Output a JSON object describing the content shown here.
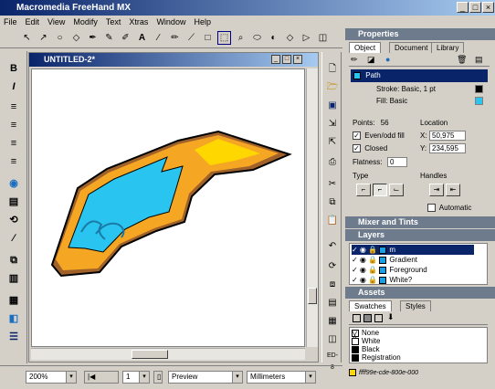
{
  "window": {
    "title": "Macromedia FreeHand MX",
    "min": "_",
    "max": "□",
    "close": "×"
  },
  "menu": [
    "File",
    "Edit",
    "View",
    "Modify",
    "Text",
    "Xtras",
    "Window",
    "Help"
  ],
  "document": {
    "title": "UNTITLED-2*"
  },
  "properties": {
    "header": "Properties",
    "tabs": [
      "Object",
      "Document",
      "Library"
    ],
    "path_label": "Path",
    "stroke_label": "Stroke: Basic, 1 pt",
    "fill_label": "Fill: Basic",
    "points_label": "Points:",
    "points_value": "56",
    "evenodd_label": "Even/odd fill",
    "closed_label": "Closed",
    "flatness_label": "Flatness:",
    "flatness_value": "0",
    "type_label": "Type",
    "location_label": "Location",
    "x_label": "X:",
    "x_value": "50,975",
    "y_label": "Y:",
    "y_value": "234,595",
    "handles_label": "Handles",
    "automatic_label": "Automatic"
  },
  "mixer": {
    "header": "Mixer and Tints"
  },
  "layers": {
    "header": "Layers",
    "items": [
      {
        "name": "m",
        "color": "#1b9ee3"
      },
      {
        "name": "Gradient",
        "color": "#1b9ee3"
      },
      {
        "name": "Foreground",
        "color": "#1b9ee3"
      },
      {
        "name": "White?",
        "color": "#1b9ee3"
      }
    ]
  },
  "assets": {
    "header": "Assets",
    "tabs": [
      "Swatches",
      "Styles"
    ],
    "swatches": [
      {
        "name": "None",
        "color": "#ffffff"
      },
      {
        "name": "White",
        "color": "#ffffff"
      },
      {
        "name": "Black",
        "color": "#000000"
      },
      {
        "name": "Registration",
        "color": "#000000"
      },
      {
        "name": "ffff99e-cde-800e-000",
        "color": "#ffd700"
      }
    ]
  },
  "status": {
    "zoom": "200%",
    "page": "1",
    "view": "Preview",
    "units": "Millimeters"
  },
  "colors": {
    "artwork_yellow": "#ffd700",
    "artwork_orange": "#f5a623",
    "artwork_cyan": "#29c5f0",
    "artwork_brown": "#a0622a"
  }
}
